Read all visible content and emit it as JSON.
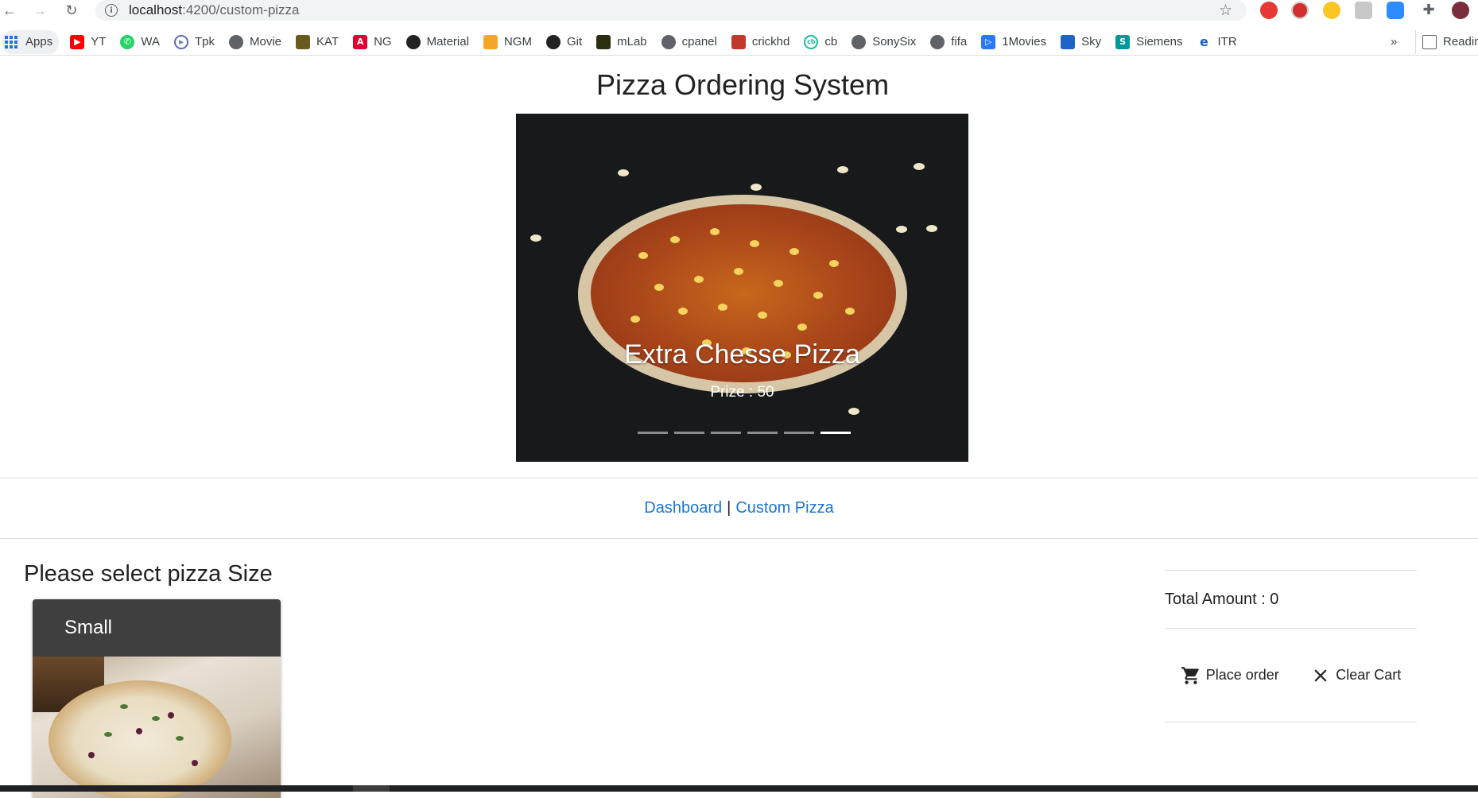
{
  "browser": {
    "url_host": "localhost",
    "url_path": ":4200/custom-pizza",
    "bookmarks": [
      "Apps",
      "YT",
      "WA",
      "Tpk",
      "Movie",
      "KAT",
      "NG",
      "Material",
      "NGM",
      "Git",
      "mLab",
      "cpanel",
      "crickhd",
      "cb",
      "SonySix",
      "fifa",
      "1Movies",
      "Sky",
      "Siemens",
      "ITR"
    ],
    "overflow": "»",
    "reading_list": "Reading"
  },
  "page": {
    "title": "Pizza Ordering System"
  },
  "carousel": {
    "slide_title": "Extra Chesse Pizza",
    "slide_price": "Prize : 50",
    "slide_count": 6,
    "active_index": 5
  },
  "nav": {
    "dashboard": "Dashboard",
    "separator": "|",
    "custom_pizza": "Custom Pizza"
  },
  "sizes": {
    "heading": "Please select pizza Size",
    "cards": [
      {
        "label": "Small"
      }
    ]
  },
  "cart": {
    "total_label": "Total Amount : 0",
    "place_order": "Place order",
    "clear_cart": "Clear Cart"
  },
  "colors": {
    "link": "#1976d2",
    "card_header": "#3f3f3f",
    "carousel_bg": "#17191b"
  }
}
